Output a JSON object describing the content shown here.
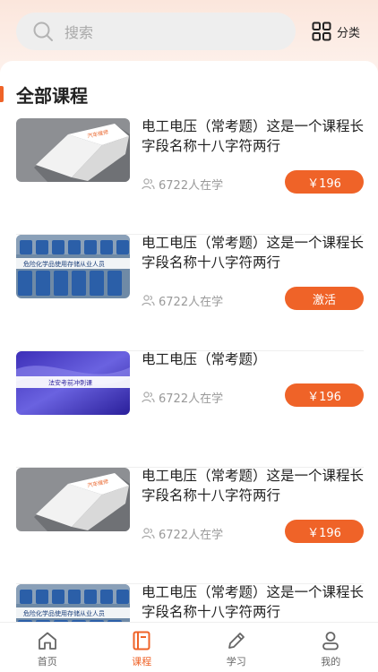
{
  "search": {
    "placeholder": "搜索"
  },
  "header": {
    "category_label": "分类"
  },
  "section": {
    "title": "全部课程"
  },
  "courses": [
    {
      "title": "电工电压（常考题）这是一个课程长字段名称十八字符两行",
      "learners": "6722人在学",
      "action": "￥196",
      "thumb": "book-image"
    },
    {
      "title": "电工电压（常考题）这是一个课程长字段名称十八字符两行",
      "learners": "6722人在学",
      "action": "激活",
      "thumb": "barrels-image",
      "thumb_caption": "危险化学品使用存储从业人员"
    },
    {
      "title": "电工电压（常考题）",
      "learners": "6722人在学",
      "action": "￥196",
      "thumb": "blue-banner-image",
      "thumb_caption": "法安考前冲刺课"
    },
    {
      "title": "电工电压（常考题）这是一个课程长字段名称十八字符两行",
      "learners": "6722人在学",
      "action": "￥196",
      "thumb": "book-image"
    },
    {
      "title": "电工电压（常考题）这是一个课程长字段名称十八字符两行",
      "learners": "",
      "action": "",
      "thumb": "barrels-image",
      "thumb_caption": "危险化学品使用存储从业人员"
    }
  ],
  "tabs": [
    {
      "label": "首页",
      "icon": "home-icon",
      "active": false
    },
    {
      "label": "课程",
      "icon": "course-icon",
      "active": true
    },
    {
      "label": "学习",
      "icon": "pencil-icon",
      "active": false
    },
    {
      "label": "我的",
      "icon": "profile-icon",
      "active": false
    }
  ],
  "colors": {
    "accent": "#ef6328",
    "muted": "#999999",
    "search_bg": "#eeeeee"
  }
}
